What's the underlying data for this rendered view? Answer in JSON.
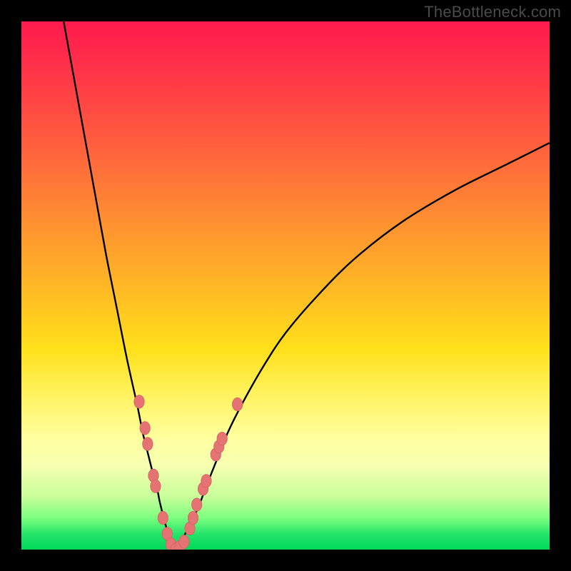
{
  "watermark": "TheBottleneck.com",
  "colors": {
    "frame": "#000000",
    "curve": "#000000",
    "marker_fill": "#e57373",
    "marker_stroke": "#d46262",
    "gradient_stops": [
      "#ff1a4d",
      "#ff5b3f",
      "#ffb726",
      "#fff56a",
      "#c8ff9a",
      "#00d858"
    ]
  },
  "chart_data": {
    "type": "line",
    "title": "",
    "xlabel": "",
    "ylabel": "",
    "xlim": [
      0,
      100
    ],
    "ylim": [
      0,
      100
    ],
    "left_curve": {
      "name": "left-branch",
      "x": [
        8,
        10,
        12,
        14,
        16,
        18,
        20,
        22,
        23,
        24,
        25,
        25.8,
        26.2,
        27.2,
        28.2,
        29.2
      ],
      "y": [
        100,
        89,
        78,
        67,
        56,
        46,
        36,
        27,
        22,
        18,
        14,
        11,
        9,
        5,
        2,
        0
      ]
    },
    "right_curve": {
      "name": "right-branch",
      "x": [
        29.2,
        30.5,
        32,
        33.5,
        35,
        37,
        39,
        42,
        46,
        50,
        56,
        63,
        72,
        82,
        92,
        100
      ],
      "y": [
        0,
        2,
        5,
        8,
        12,
        17,
        22,
        28,
        35,
        41,
        48,
        55,
        62,
        68,
        73,
        77
      ]
    },
    "markers": [
      {
        "x": 22.3,
        "y": 28
      },
      {
        "x": 23.4,
        "y": 23
      },
      {
        "x": 23.9,
        "y": 20
      },
      {
        "x": 25.0,
        "y": 14
      },
      {
        "x": 25.4,
        "y": 12
      },
      {
        "x": 26.8,
        "y": 6
      },
      {
        "x": 27.6,
        "y": 3
      },
      {
        "x": 28.3,
        "y": 1
      },
      {
        "x": 29.2,
        "y": 0
      },
      {
        "x": 30.0,
        "y": 0.5
      },
      {
        "x": 30.8,
        "y": 1.5
      },
      {
        "x": 31.9,
        "y": 4
      },
      {
        "x": 32.5,
        "y": 6
      },
      {
        "x": 33.2,
        "y": 8.5
      },
      {
        "x": 34.4,
        "y": 11.5
      },
      {
        "x": 35.0,
        "y": 13
      },
      {
        "x": 36.8,
        "y": 18
      },
      {
        "x": 37.4,
        "y": 19.5
      },
      {
        "x": 38.0,
        "y": 21
      },
      {
        "x": 40.9,
        "y": 27.5
      }
    ]
  }
}
